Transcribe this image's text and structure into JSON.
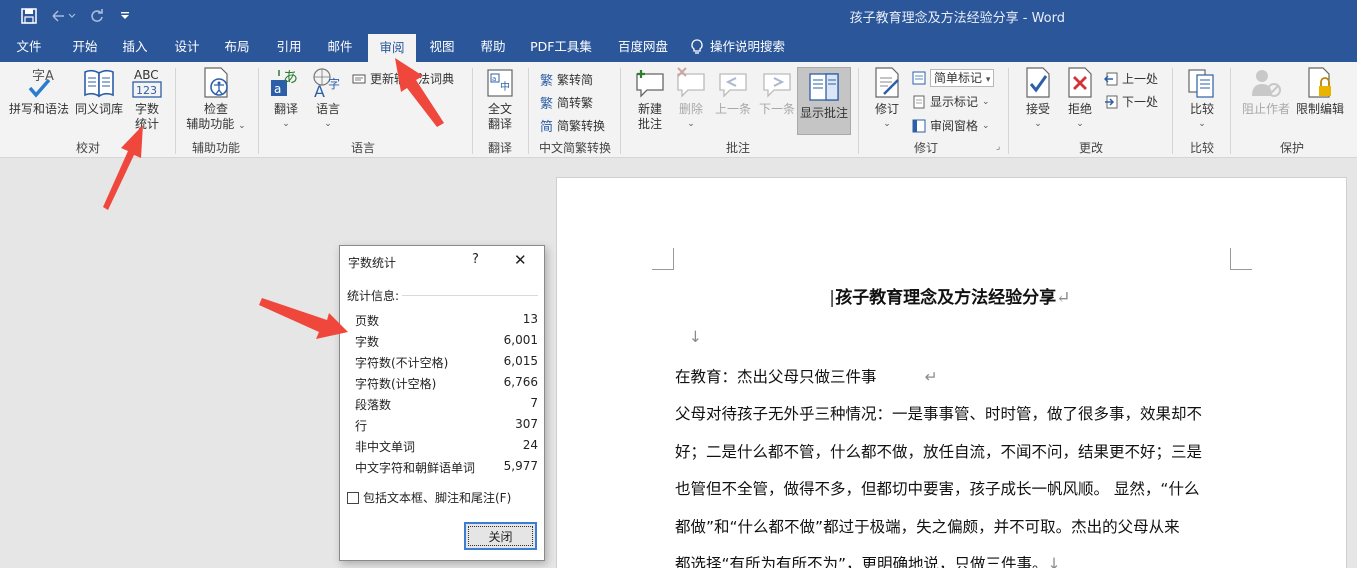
{
  "app": {
    "doc_title": "孩子教育理念及方法经验分享 - Word",
    "quick_access": [
      "save-icon",
      "undo-icon",
      "redo-icon",
      "customize-quick-access-icon"
    ]
  },
  "tabs": [
    "文件",
    "开始",
    "插入",
    "设计",
    "布局",
    "引用",
    "邮件",
    "审阅",
    "视图",
    "帮助",
    "PDF工具集",
    "百度网盘"
  ],
  "active_tab": "审阅",
  "tell_me": "操作说明搜索",
  "ribbon": {
    "proofing": {
      "label": "校对",
      "spell": "拼写和语法",
      "thesaurus": "同义词库",
      "wordcount_1": "字数",
      "wordcount_2": "统计"
    },
    "accessibility": {
      "label": "辅助功能",
      "check_1": "检查",
      "check_2": "辅助功能"
    },
    "language": {
      "label": "语言",
      "translate": "翻译",
      "language": "语言",
      "update_ime": "更新输入法词典"
    },
    "translate": {
      "label": "翻译",
      "full_1": "全文",
      "full_2": "翻译"
    },
    "chinese": {
      "label": "中文简繁转换",
      "to_simplified": "繁转简",
      "to_traditional": "简转繁",
      "convert": "简繁转换"
    },
    "comments": {
      "label": "批注",
      "new_1": "新建",
      "new_2": "批注",
      "delete": "删除",
      "prev": "上一条",
      "next": "下一条",
      "show": "显示批注"
    },
    "tracking": {
      "label": "修订",
      "track": "修订",
      "markup": "简单标记",
      "show_markup": "显示标记",
      "reviewing_pane": "审阅窗格"
    },
    "changes": {
      "label": "更改",
      "accept": "接受",
      "reject": "拒绝",
      "prev": "上一处",
      "next": "下一处"
    },
    "compare": {
      "label": "比较",
      "compare": "比较"
    },
    "protect": {
      "label": "保护",
      "block_authors": "阻止作者",
      "restrict": "限制编辑"
    }
  },
  "document": {
    "heading": "孩子教育理念及方法经验分享",
    "lines": [
      "在教育：杰出父母只做三件事",
      "父母对待孩子无外乎三种情况：一是事事管、时时管，做了很多事，效果却不",
      "好；二是什么都不管，什么都不做，放任自流，不闻不问，结果更不好；三是",
      "也管但不全管，做得不多，但都切中要害，孩子成长一帆风顺。 显然，“什么",
      "都做”和“什么都不做”都过于极端，失之偏颇，并不可取。杰出的父母从来",
      "都选择“有所为有所不为”，更明确地说，只做三件事。"
    ]
  },
  "dialog": {
    "title": "字数统计",
    "help": "?",
    "section": "统计信息:",
    "stats": [
      {
        "label": "页数",
        "value": "13"
      },
      {
        "label": "字数",
        "value": "6,001"
      },
      {
        "label": "字符数(不计空格)",
        "value": "6,015"
      },
      {
        "label": "字符数(计空格)",
        "value": "6,766"
      },
      {
        "label": "段落数",
        "value": "7"
      },
      {
        "label": "行",
        "value": "307"
      },
      {
        "label": "非中文单词",
        "value": "24"
      },
      {
        "label": "中文字符和朝鲜语单词",
        "value": "5,977"
      }
    ],
    "checkbox_label": "包括文本框、脚注和尾注(F)",
    "checkbox_checked": false,
    "close_label": "关闭"
  },
  "colors": {
    "title_bar": "#2b579a",
    "ribbon": "#f3f3f3",
    "arrow": "#f0473c",
    "focus": "#3c7fd1"
  }
}
